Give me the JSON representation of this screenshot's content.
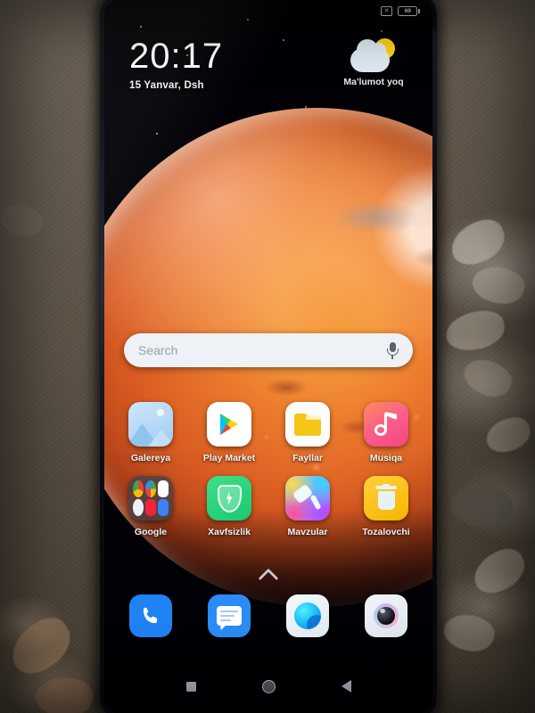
{
  "device": {
    "type": "smartphone",
    "orientation": "portrait",
    "screen_state": "home-screen"
  },
  "background": {
    "description": "patterned carpet",
    "colors": [
      "#6d6357",
      "#5d5347",
      "#4a4136",
      "#3a3329"
    ]
  },
  "wallpaper": {
    "subject": "mars-planet",
    "sky_color": "#020206",
    "planet_colors": [
      "#f59a3c",
      "#ec7a2c",
      "#d95b22",
      "#b0401a",
      "#7d2a12"
    ]
  },
  "statusbar": {
    "icons": [
      {
        "name": "silent-mode-icon",
        "glyph": "✕"
      },
      {
        "name": "battery-icon",
        "level": "69"
      }
    ]
  },
  "clock_widget": {
    "time": "20:17",
    "date": "15 Yanvar, Dsh"
  },
  "weather_widget": {
    "icon": "sun-behind-cloud-icon",
    "text": "Ma'lumot yoq"
  },
  "search": {
    "placeholder": "Search",
    "mic_icon": "microphone-icon"
  },
  "app_rows": [
    {
      "apps": [
        {
          "label": "Galereya",
          "icon": "gallery-icon"
        },
        {
          "label": "Play Market",
          "icon": "play-store-icon"
        },
        {
          "label": "Fayllar",
          "icon": "files-folder-icon"
        },
        {
          "label": "Musiqa",
          "icon": "music-note-icon"
        }
      ]
    },
    {
      "apps": [
        {
          "label": "Google",
          "icon": "google-folder-icon"
        },
        {
          "label": "Xavfsizlik",
          "icon": "security-shield-icon"
        },
        {
          "label": "Mavzular",
          "icon": "themes-roller-icon"
        },
        {
          "label": "Tozalovchi",
          "icon": "cleaner-trash-icon"
        }
      ]
    }
  ],
  "app_drawer": {
    "indicator": "chevron-up-icon"
  },
  "dock": {
    "apps": [
      {
        "label": "Phone",
        "icon": "phone-handset-icon"
      },
      {
        "label": "Messages",
        "icon": "message-bubble-icon"
      },
      {
        "label": "Browser",
        "icon": "browser-globe-icon"
      },
      {
        "label": "Camera",
        "icon": "camera-lens-icon"
      }
    ]
  },
  "navbar": {
    "buttons": [
      {
        "name": "recents-button",
        "shape": "square"
      },
      {
        "name": "home-button",
        "shape": "circle"
      },
      {
        "name": "back-button",
        "shape": "triangle"
      }
    ]
  }
}
